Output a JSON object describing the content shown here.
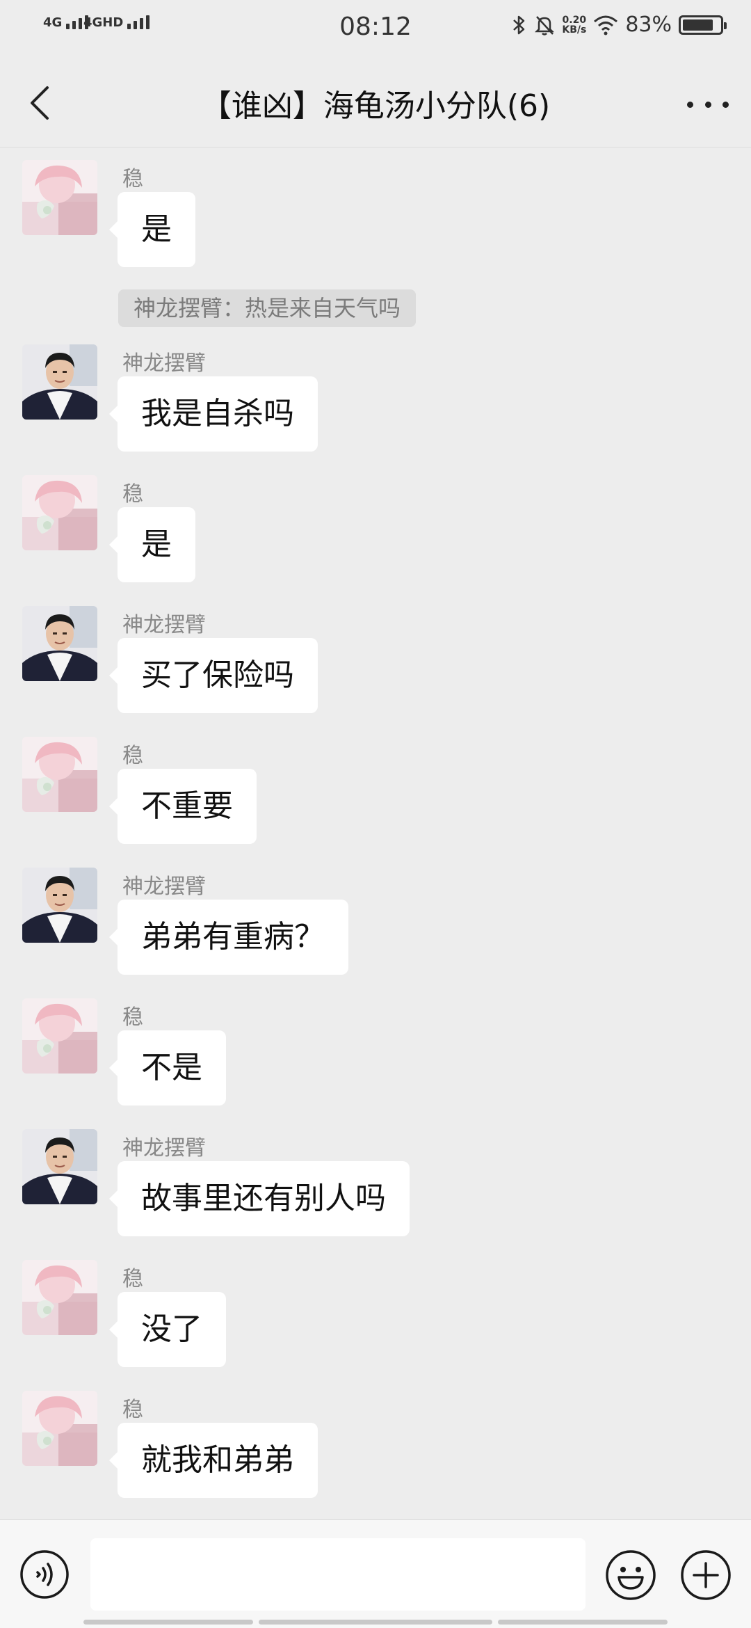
{
  "status_bar": {
    "signal_1": "4G",
    "signal_2": "4GHD",
    "time": "08:12",
    "net_speed_value": "0.20",
    "net_speed_unit": "KB/s",
    "battery_percent": "83%",
    "battery_level": 0.83
  },
  "header": {
    "title": "【谁凶】海龟汤小分队(6)"
  },
  "messages": [
    {
      "sender": "稳",
      "text": "是",
      "quote": "神龙摆臂：热是来自天气吗"
    },
    {
      "sender": "神龙摆臂",
      "text": "我是自杀吗"
    },
    {
      "sender": "稳",
      "text": "是"
    },
    {
      "sender": "神龙摆臂",
      "text": "买了保险吗"
    },
    {
      "sender": "稳",
      "text": "不重要"
    },
    {
      "sender": "神龙摆臂",
      "text": "弟弟有重病？"
    },
    {
      "sender": "稳",
      "text": "不是"
    },
    {
      "sender": "神龙摆臂",
      "text": "故事里还有别人吗"
    },
    {
      "sender": "稳",
      "text": "没了"
    },
    {
      "sender": "稳",
      "text": "就我和弟弟"
    }
  ],
  "input": {
    "value": "",
    "placeholder": ""
  },
  "icons": {
    "back": "chevron-left-icon",
    "more": "more-horizontal-icon",
    "voice": "voice-icon",
    "emoji": "emoji-icon",
    "plus": "plus-icon"
  }
}
